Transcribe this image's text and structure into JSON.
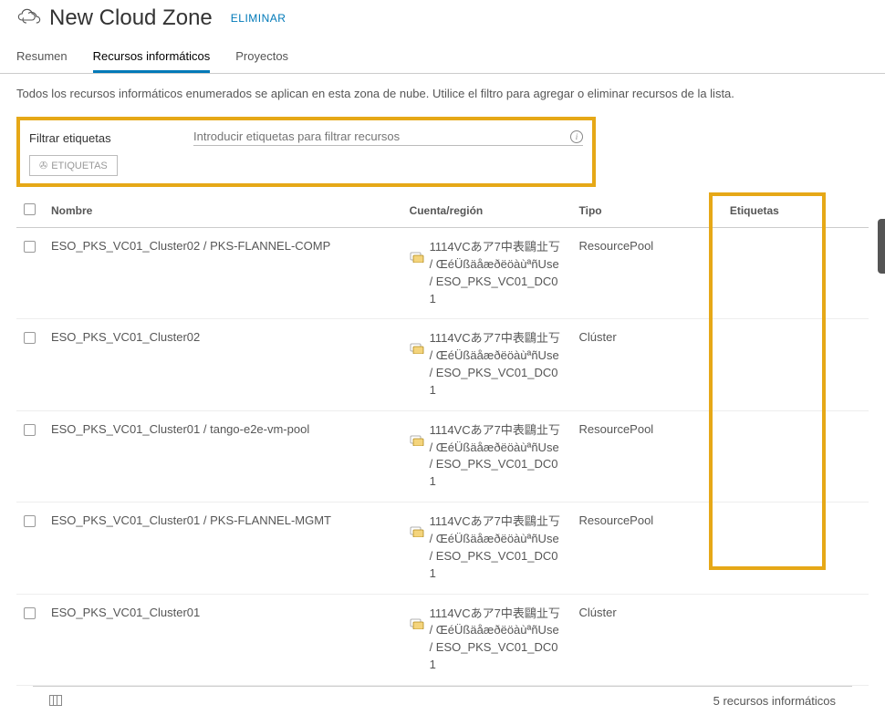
{
  "header": {
    "title": "New Cloud Zone",
    "delete_label": "ELIMINAR"
  },
  "tabs": {
    "summary": "Resumen",
    "compute": "Recursos informáticos",
    "projects": "Proyectos"
  },
  "description": "Todos los recursos informáticos enumerados se aplican en esta zona de nube. Utilice el filtro para agregar o eliminar recursos de la lista.",
  "filter": {
    "label": "Filtrar etiquetas",
    "placeholder": "Introducir etiquetas para filtrar recursos",
    "tags_button": "ETIQUETAS"
  },
  "columns": {
    "name": "Nombre",
    "account": "Cuenta/región",
    "type": "Tipo",
    "tags": "Etiquetas"
  },
  "account_line1": "1114VCあア7中表鷗㐀丂 / ŒéÜßäåæðëöàùªñUse / ESO_PKS_VC01_DC01",
  "rows": [
    {
      "name": "ESO_PKS_VC01_Cluster02 / PKS-FLANNEL-COMP",
      "type": "ResourcePool"
    },
    {
      "name": "ESO_PKS_VC01_Cluster02",
      "type": "Clúster"
    },
    {
      "name": "ESO_PKS_VC01_Cluster01 / tango-e2e-vm-pool",
      "type": "ResourcePool"
    },
    {
      "name": "ESO_PKS_VC01_Cluster01 / PKS-FLANNEL-MGMT",
      "type": "ResourcePool"
    },
    {
      "name": "ESO_PKS_VC01_Cluster01",
      "type": "Clúster"
    }
  ],
  "footer": {
    "count_label": "5 recursos informáticos"
  }
}
